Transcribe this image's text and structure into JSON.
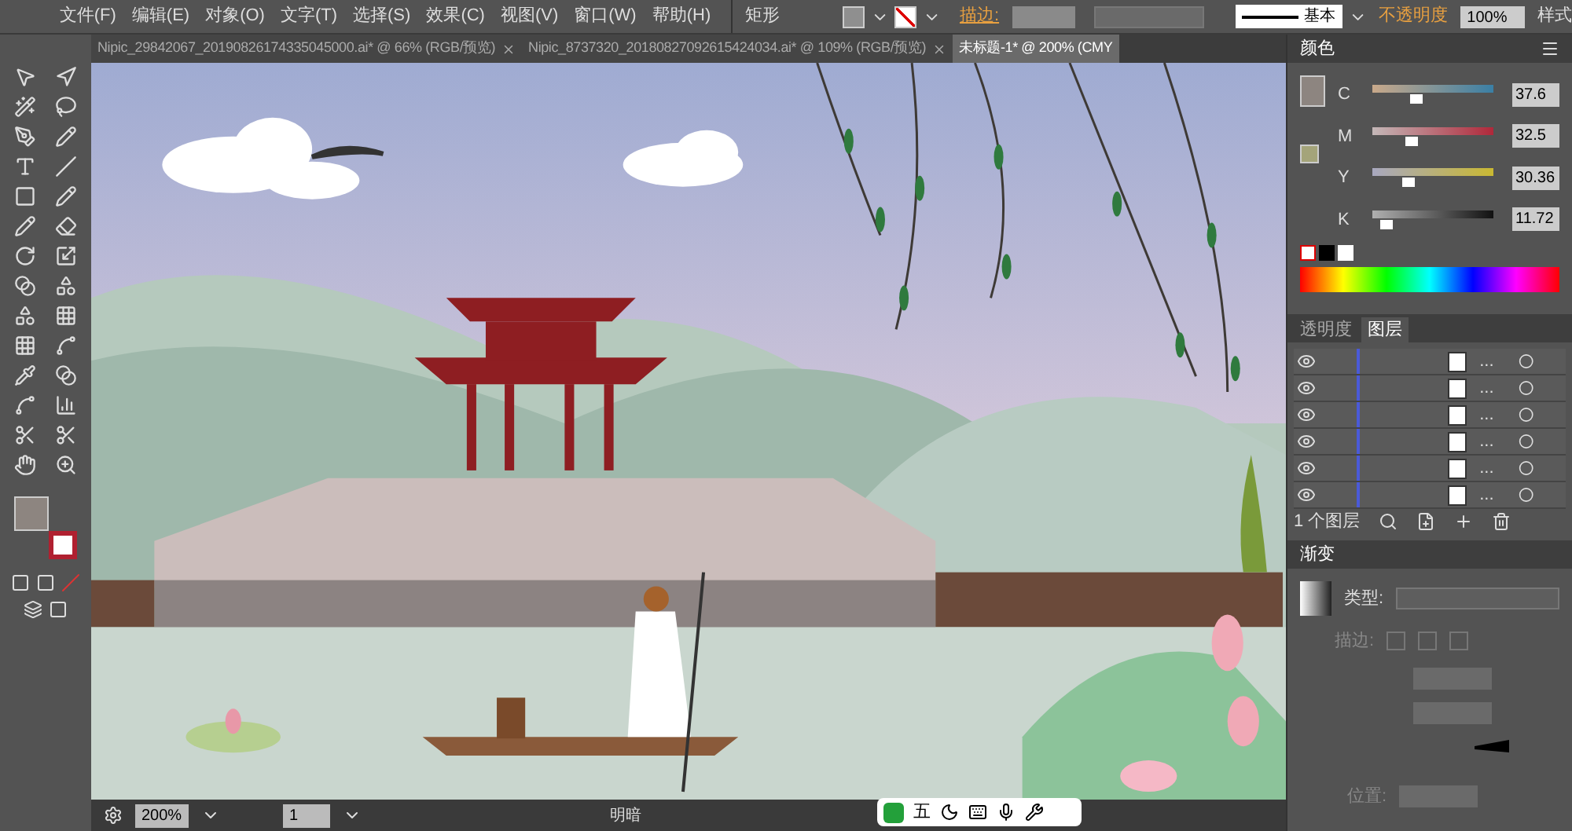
{
  "menu": [
    "文件(F)",
    "编辑(E)",
    "对象(O)",
    "文字(T)",
    "选择(S)",
    "效果(C)",
    "视图(V)",
    "窗口(W)",
    "帮助(H)"
  ],
  "control_bar": {
    "object_type": "矩形",
    "stroke_label": "描边:",
    "brush": "基本",
    "opacity_label": "不透明度",
    "opacity": "100%",
    "style_label": "样式"
  },
  "doc_tabs": [
    {
      "title": "Nipic_29842067_20190826174335045000.ai* @ 66% (RGB/预览)",
      "selected": false
    },
    {
      "title": "Nipic_8737320_20180827092615424034.ai* @ 109% (RGB/预览)",
      "selected": false
    },
    {
      "title": "未标题-1* @ 200% (CMY",
      "selected": true
    }
  ],
  "color_panel": {
    "title": "颜色",
    "channels": [
      {
        "name": "C",
        "level": 0.37,
        "value": "37.6"
      },
      {
        "name": "M",
        "level": 0.33,
        "value": "32.5"
      },
      {
        "name": "Y",
        "level": 0.3,
        "value": "30.36"
      },
      {
        "name": "K",
        "level": 0.12,
        "value": "11.72"
      }
    ]
  },
  "layers_panel": {
    "tabs": [
      {
        "label": "透明度",
        "selected": false
      },
      {
        "label": "图层",
        "selected": true
      }
    ],
    "rows": [
      {
        "name": "...",
        "visible": true
      },
      {
        "name": "...",
        "visible": true
      },
      {
        "name": "...",
        "visible": true
      },
      {
        "name": "...",
        "visible": true
      },
      {
        "name": "...",
        "visible": true
      },
      {
        "name": "...",
        "visible": true
      }
    ],
    "footer": "1 个图层"
  },
  "gradient_panel": {
    "title": "渐变",
    "type_label": "类型:",
    "stroke_label": "描边:",
    "position_label": "位置:"
  },
  "status_bar": {
    "zoom": "200%",
    "artboard": "1",
    "tool": "明暗"
  },
  "ime_bar": {
    "mode": "五"
  }
}
